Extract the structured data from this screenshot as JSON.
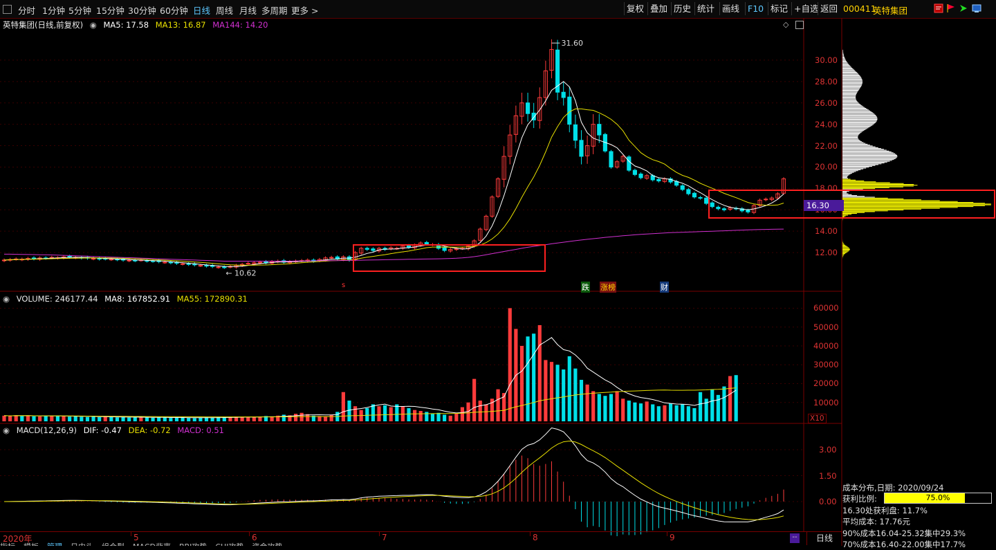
{
  "toolbar": {
    "periods": [
      "分时",
      "1分钟",
      "5分钟",
      "15分钟",
      "30分钟",
      "60分钟",
      "日线",
      "周线",
      "月线",
      "多周期",
      "更多 >"
    ],
    "active_period": "日线",
    "right_buttons": [
      "复权",
      "叠加",
      "历史",
      "统计",
      "画线",
      "F10",
      "标记",
      "+自选",
      "返回"
    ],
    "stock_code": "000411",
    "stock_name": "英特集团"
  },
  "kline_panel": {
    "title": "英特集团(日线,前复权)",
    "ma5": "MA5: 17.58",
    "ma13": "MA13: 16.87",
    "ma144": "MA144: 14.20",
    "high_label": "31.60",
    "low_label": "10.62",
    "current_price_tag": "16.30",
    "y_ticks": [
      "30.00",
      "28.00",
      "26.00",
      "24.00",
      "22.00",
      "20.00",
      "18.00",
      "16.00",
      "14.00",
      "12.00"
    ],
    "event_badges": [
      "跌",
      "涨榜",
      "财"
    ],
    "small_marker": "s"
  },
  "volume_panel": {
    "label": "VOLUME: 246177.44",
    "ma8": "MA8: 167852.91",
    "ma55": "MA55: 172890.31",
    "y_ticks": [
      "60000",
      "50000",
      "40000",
      "30000",
      "20000",
      "10000"
    ],
    "unit": "X10"
  },
  "macd_panel": {
    "label": "MACD(12,26,9)",
    "dif": "DIF: -0.47",
    "dea": "DEA: -0.72",
    "macd": "MACD: 0.51",
    "y_ticks": [
      "3.00",
      "1.50",
      "0.00"
    ]
  },
  "time_axis": {
    "labels": [
      "2020年",
      "5",
      "6",
      "7",
      "8",
      "9"
    ],
    "period": "日线"
  },
  "cost_distribution": {
    "title": "成本分布,日期: 2020/09/24",
    "profit_ratio_label": "获利比例:",
    "profit_ratio_value": "75.0%",
    "profit_ratio_fraction": 0.75,
    "price_profit": "16.30处获利盘: 11.7%",
    "avg_cost": "平均成本: 17.76元",
    "cost90": "90%成本16.04-25.32集中29.3%",
    "cost70": "70%成本16.40-22.00集中17.7%"
  },
  "bottom_tabs": [
    "指标",
    "模板",
    "管理",
    "日内头",
    "组合型",
    "MACD背离",
    "BBI攻势",
    "CHI攻势",
    "资金攻势"
  ],
  "colors": {
    "up": "#ff3b3b",
    "down": "#00e0e8",
    "ma5": "#ffffff",
    "ma13": "#e8e000",
    "ma144": "#d030d0",
    "axis": "#d33333",
    "highlight_box": "#ff2020",
    "chip": "#ffff00"
  },
  "chart_data": {
    "type": "candlestick",
    "kline": {
      "ylim": [
        10.0,
        32.0
      ],
      "close_series": [
        11.3,
        11.35,
        11.4,
        11.38,
        11.45,
        11.42,
        11.5,
        11.48,
        11.55,
        11.52,
        11.6,
        11.58,
        11.55,
        11.5,
        11.48,
        11.45,
        11.4,
        11.42,
        11.38,
        11.35,
        11.3,
        11.28,
        11.25,
        11.3,
        11.22,
        11.2,
        11.15,
        11.1,
        11.05,
        11.0,
        10.95,
        10.9,
        10.85,
        10.8,
        10.75,
        10.7,
        10.65,
        10.62,
        10.7,
        10.8,
        10.9,
        11.0,
        11.05,
        11.1,
        11.05,
        11.15,
        11.2,
        11.1,
        11.15,
        11.2,
        11.25,
        11.3,
        11.2,
        11.35,
        11.5,
        11.55,
        11.4,
        11.6,
        11.3,
        12.0,
        12.4,
        12.3,
        12.2,
        12.4,
        12.3,
        12.45,
        12.4,
        12.6,
        12.5,
        12.7,
        12.9,
        12.8,
        12.75,
        12.4,
        12.2,
        12.3,
        12.35,
        12.4,
        12.6,
        13.1,
        14.2,
        15.4,
        17.2,
        18.9,
        21.0,
        23.0,
        24.8,
        26.0,
        25.0,
        24.4,
        26.5,
        29.0,
        31.0,
        27.0,
        26.5,
        24.0,
        22.5,
        21.0,
        22.0,
        24.0,
        23.0,
        21.5,
        20.0,
        20.5,
        21.0,
        19.7,
        19.3,
        19.0,
        19.2,
        18.8,
        18.7,
        18.9,
        18.6,
        18.3,
        17.9,
        17.5,
        17.2,
        17.1,
        16.6,
        16.3,
        16.1,
        16.0,
        16.2,
        16.1,
        15.9,
        15.8,
        16.4,
        16.9,
        17.0,
        17.1,
        17.5,
        18.9
      ],
      "ma144": [
        11.85,
        11.85,
        11.84,
        11.83,
        11.82,
        11.81,
        11.8,
        11.79,
        11.78,
        11.76,
        11.74,
        11.72,
        11.7,
        11.68,
        11.66,
        11.64,
        11.62,
        11.6,
        11.58,
        11.56,
        11.54,
        11.52,
        11.5,
        11.48,
        11.46,
        11.44,
        11.42,
        11.4,
        11.38,
        11.36,
        11.34,
        11.32,
        11.3,
        11.28,
        11.26,
        11.24,
        11.22,
        11.2,
        11.2,
        11.2,
        11.2,
        11.2,
        11.2,
        11.2,
        11.2,
        11.2,
        11.2,
        11.2,
        11.2,
        11.21,
        11.22,
        11.22,
        11.23,
        11.24,
        11.24,
        11.25,
        11.25,
        11.26,
        11.27,
        11.28,
        11.29,
        11.3,
        11.31,
        11.32,
        11.33,
        11.34,
        11.35,
        11.36,
        11.37,
        11.38,
        11.39,
        11.4,
        11.41,
        11.42,
        11.43,
        11.45,
        11.47,
        11.5,
        11.55,
        11.62,
        11.7,
        11.8,
        11.9,
        12.0,
        12.1,
        12.2,
        12.3,
        12.4,
        12.5,
        12.58,
        12.66,
        12.74,
        12.82,
        12.9,
        12.97,
        13.04,
        13.11,
        13.18,
        13.24,
        13.3,
        13.36,
        13.42,
        13.47,
        13.52,
        13.57,
        13.62,
        13.66,
        13.7,
        13.74,
        13.77,
        13.8,
        13.83,
        13.86,
        13.88,
        13.9,
        13.92,
        13.94,
        13.96,
        13.98,
        14.0,
        14.02,
        14.04,
        14.06,
        14.08,
        14.1,
        14.12,
        14.14,
        14.16,
        14.17,
        14.18,
        14.19,
        14.2
      ]
    },
    "volume": {
      "ylim": [
        0,
        62000
      ],
      "values": [
        3000,
        2800,
        3200,
        2900,
        3100,
        2700,
        2600,
        2900,
        3000,
        2800,
        2700,
        2500,
        2600,
        2400,
        2300,
        2500,
        2200,
        2400,
        2300,
        2100,
        2200,
        2000,
        2100,
        2300,
        2000,
        1900,
        2100,
        2000,
        1800,
        1900,
        2000,
        1800,
        1700,
        1900,
        2100,
        2000,
        2200,
        2400,
        2300,
        2500,
        2200,
        2100,
        2300,
        2500,
        2800,
        2600,
        3000,
        3500,
        3200,
        4000,
        4500,
        3800,
        3000,
        2800,
        2600,
        3500,
        5000,
        15500,
        11000,
        8000,
        6000,
        7000,
        9000,
        8000,
        8500,
        7500,
        9000,
        8000,
        7000,
        6000,
        5500,
        5000,
        4000,
        4500,
        3500,
        3000,
        4000,
        7500,
        10000,
        22500,
        11000,
        9000,
        12000,
        17000,
        15000,
        60000,
        49000,
        40000,
        45000,
        46500,
        51000,
        32500,
        31500,
        30000,
        27500,
        34500,
        28000,
        22000,
        19500,
        16000,
        14500,
        13500,
        14500,
        16000,
        12000,
        11000,
        10000,
        9500,
        10500,
        9000,
        8000,
        8500,
        9500,
        8500,
        9000,
        8000,
        7000,
        15500,
        12000,
        17000,
        14000,
        18500,
        24000,
        24500
      ]
    },
    "macd": {
      "ylim": [
        -1.6,
        4.0
      ]
    }
  }
}
